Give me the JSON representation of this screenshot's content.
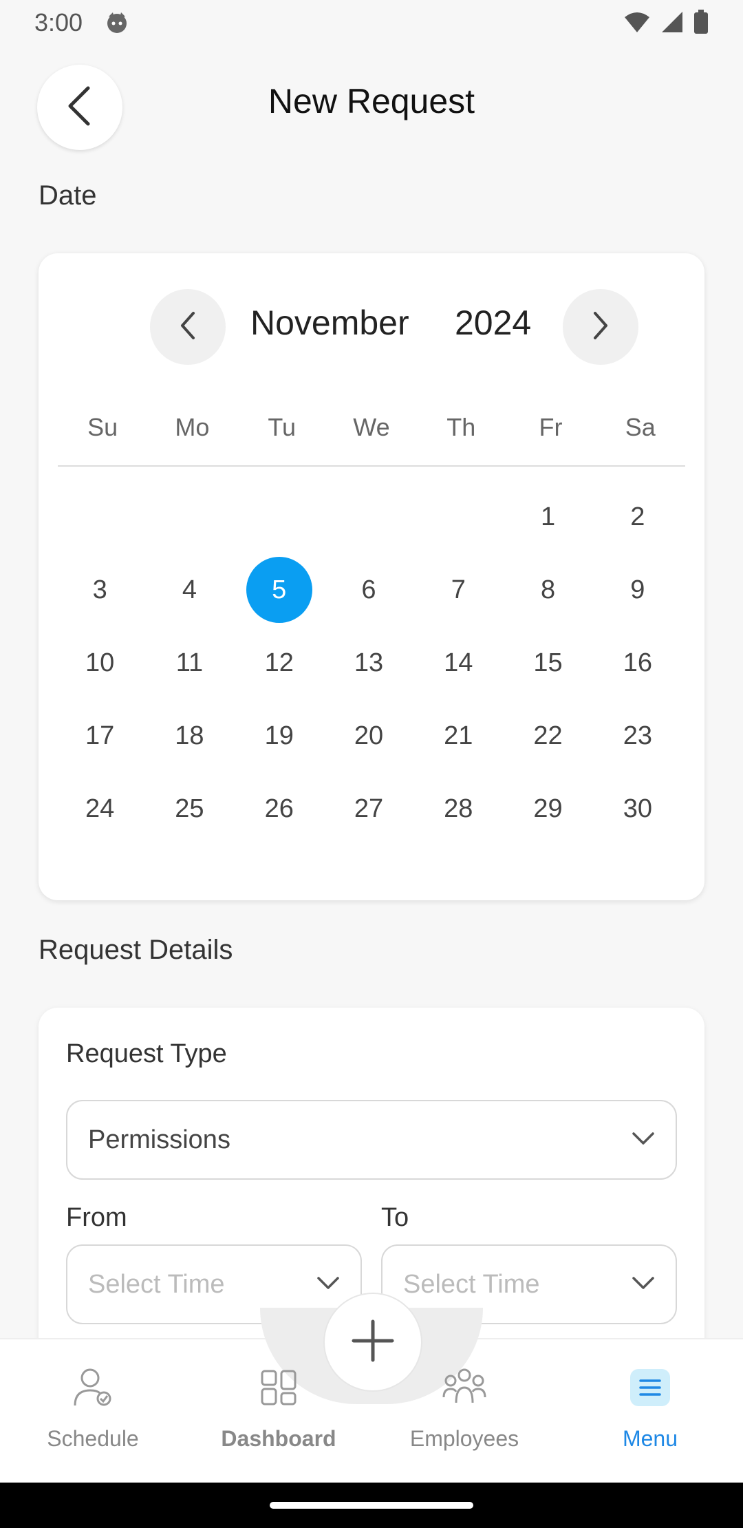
{
  "status_bar": {
    "time": "3:00"
  },
  "header": {
    "title": "New Request"
  },
  "date_section": {
    "label": "Date"
  },
  "calendar": {
    "month": "November",
    "year": "2024",
    "weekdays": [
      "Su",
      "Mo",
      "Tu",
      "We",
      "Th",
      "Fr",
      "Sa"
    ],
    "weeks": [
      [
        "",
        "",
        "",
        "",
        "",
        "1",
        "2"
      ],
      [
        "3",
        "4",
        "5",
        "6",
        "7",
        "8",
        "9"
      ],
      [
        "10",
        "11",
        "12",
        "13",
        "14",
        "15",
        "16"
      ],
      [
        "17",
        "18",
        "19",
        "20",
        "21",
        "22",
        "23"
      ],
      [
        "24",
        "25",
        "26",
        "27",
        "28",
        "29",
        "30"
      ]
    ],
    "selected_day": "5",
    "accent_color": "#0a9ef2"
  },
  "details_section": {
    "label": "Request Details",
    "request_type_label": "Request Type",
    "request_type_value": "Permissions",
    "from_label": "From",
    "to_label": "To",
    "from_placeholder": "Select Time",
    "to_placeholder": "Select Time"
  },
  "bottom_nav": {
    "items": [
      {
        "label": "Schedule",
        "icon": "person-check-icon"
      },
      {
        "label": "Dashboard",
        "icon": "grid-icon"
      },
      {
        "label": "Employees",
        "icon": "group-icon"
      },
      {
        "label": "Menu",
        "icon": "menu-icon",
        "active": true
      }
    ],
    "active_color": "#1e88e5"
  }
}
